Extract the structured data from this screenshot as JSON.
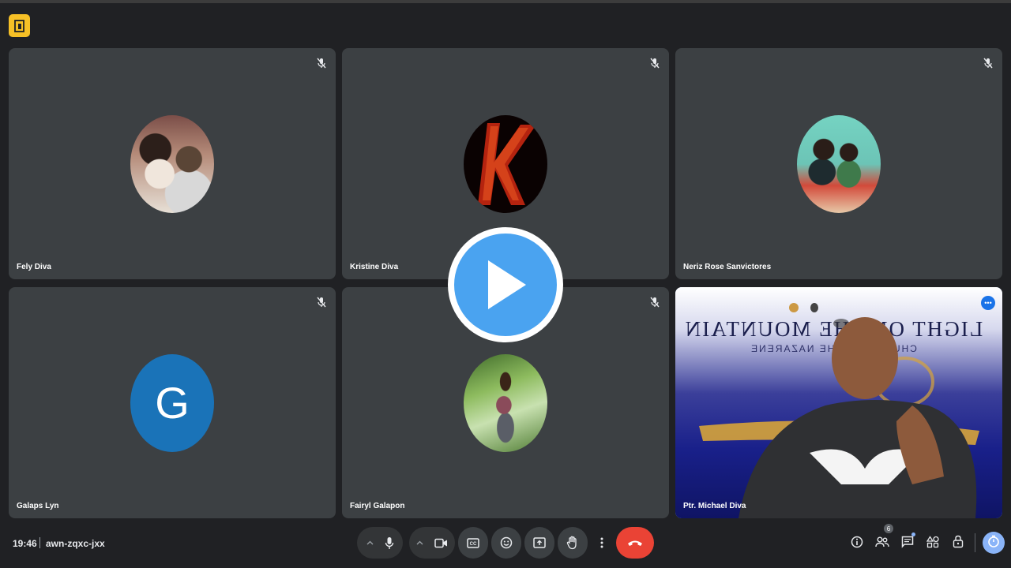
{
  "app": {
    "logo_icon": "meet-app-icon"
  },
  "participants": [
    {
      "name": "Fely Diva",
      "avatar": "photo",
      "muted": true
    },
    {
      "name": "Kristine Diva",
      "avatar": "photo-letter-K",
      "muted": true
    },
    {
      "name": "Neriz Rose Sanvictores",
      "avatar": "photo",
      "muted": true
    },
    {
      "name": "Galaps Lyn",
      "avatar_letter": "G",
      "muted": true
    },
    {
      "name": "Fairyl Galapon",
      "avatar": "photo",
      "muted": true
    },
    {
      "name": "Ptr. Michael Diva",
      "avatar": "video",
      "speaking": true
    }
  ],
  "video_banner": {
    "line1": "LIGHT ON THE MOUNTAIN",
    "line2": "CHURCH OF THE NAZARENE"
  },
  "overlay": {
    "icon": "play-icon"
  },
  "bottom_bar": {
    "time": "19:46",
    "meeting_code": "awn-zqxc-jxx",
    "controls": [
      "chevron-up-icon",
      "microphone-icon",
      "chevron-up-icon",
      "camera-icon",
      "captions-icon",
      "emoji-icon",
      "present-icon",
      "raise-hand-icon",
      "more-vert-icon",
      "end-call-icon"
    ],
    "right_controls": [
      "info-icon",
      "people-icon",
      "chat-icon",
      "activities-icon",
      "lock-icon",
      "timer-icon"
    ],
    "people_count": "6"
  },
  "colors": {
    "end_call": "#ea4335",
    "accent": "#8ab4f8",
    "tile": "#3c4043",
    "background": "#202124"
  }
}
